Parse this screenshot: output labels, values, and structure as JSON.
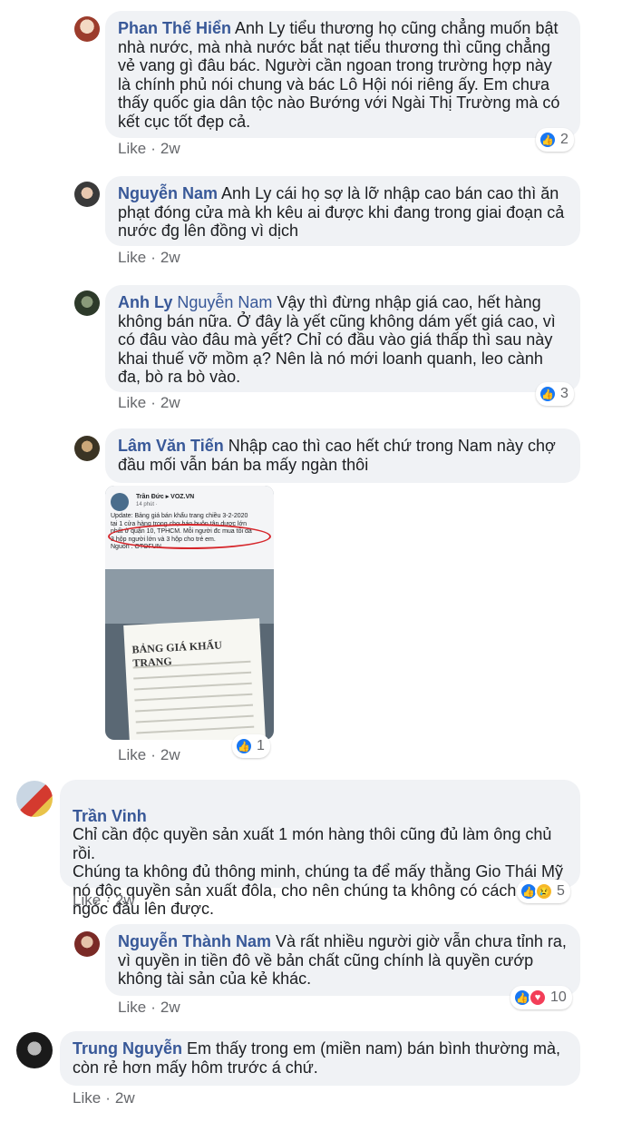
{
  "comments": [
    {
      "name": "Phan Thế Hiển",
      "text": "Anh Ly tiểu thương họ cũng chẳng muốn bật nhà nước, mà nhà nước bắt nạt tiểu thương thì cũng chẳng vẻ vang gì đâu bác. Người cần ngoan trong trường hợp này là chính phủ nói chung và bác Lô Hội nói riêng ấy. Em chưa thấy quốc gia dân tộc nào Bướng với Ngài Thị Trường mà có kết cục tốt đẹp cả.",
      "like": "Like",
      "time": "2w",
      "reaction_count": "2"
    },
    {
      "name": "Nguyễn Nam",
      "text": "Anh Ly cái họ sợ là lỡ nhập cao bán cao thì ăn phạt đóng cửa mà kh kêu ai được khi đang trong giai đoạn cả nước đg lên đồng vì dịch",
      "like": "Like",
      "time": "2w"
    },
    {
      "name": "Anh Ly",
      "mention": "Nguyễn Nam",
      "text": "Vậy thì đừng nhập giá cao, hết hàng không bán nữa. Ở đây là yết cũng không dám yết giá cao, vì có đâu vào đâu mà yết? Chỉ có đầu vào giá thấp thì sau này khai thuế vỡ mồm ạ? Nên là nó mới loanh quanh, leo cành đa, bò ra bò vào.",
      "like": "Like",
      "time": "2w",
      "reaction_count": "3"
    },
    {
      "name": "Lâm Văn Tiến",
      "text": "Nhập cao thì cao hết chứ trong Nam này chợ đầu mối vẫn bán ba mấy ngàn thôi",
      "like": "Like",
      "time": "2w",
      "reaction_count": "1",
      "image": {
        "author": "Trần Đức ▸ VOZ.VN",
        "time": "14 phút · ",
        "text": "Update: Bảng giá bán khẩu trang chiều 3-2-2020\ntại 1 cửa hàng trong chợ bán buôn tân dược lớn\nnhất ở quận 10, TPHCM. Mỗi người đc mua tối đa\n3 hộp người lớn và 3 hộp cho trẻ em.\nNguồn : OTOFUN",
        "board_title": "BẢNG GIÁ KHẨU TRANG"
      }
    },
    {
      "name": "Trần Vinh",
      "text": "Chỉ cần độc quyền sản xuất 1 món hàng thôi cũng đủ làm ông chủ rồi.\nChúng ta không đủ thông minh, chúng ta để mấy thằng Gio Thái Mỹ nó độc quyền sản xuất đôla, cho nên chúng ta không có cách nào ngóc đầu lên được.",
      "like": "Like",
      "time": "2w",
      "reaction_count": "5"
    },
    {
      "name": "Nguyễn Thành Nam",
      "text": "Và rất nhiều người giờ vẫn chưa tỉnh ra, vì quyền in tiền đô về bản chất cũng chính là quyền cướp không tài sản của kẻ khác.",
      "like": "Like",
      "time": "2w",
      "reaction_count": "10"
    },
    {
      "name": "Trung Nguyễn",
      "text": "Em thấy trong em (miền nam) bán bình thường mà, còn rẻ hơn mấy hôm trước á chứ.",
      "like": "Like",
      "time": "2w"
    }
  ],
  "meta_separator": "·",
  "colors": {
    "name": "#385898",
    "bubble": "#f0f2f5",
    "like_reaction": "#1877f2",
    "love_reaction": "#f33e58",
    "sad_reaction": "#f7b928"
  }
}
